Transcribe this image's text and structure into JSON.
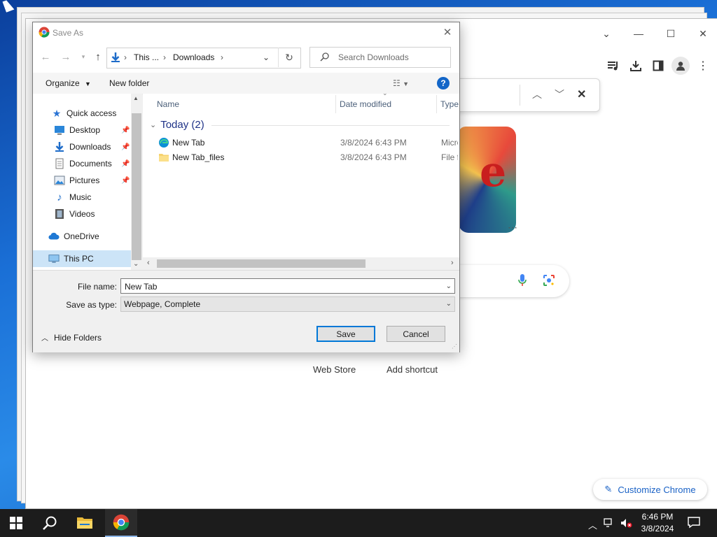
{
  "dialog": {
    "title": "Save As",
    "breadcrumb": [
      "This ...",
      "Downloads"
    ],
    "search_placeholder": "Search Downloads",
    "organize_label": "Organize",
    "new_folder_label": "New folder",
    "help_glyph": "?",
    "nav_pane": {
      "quick_access": "Quick access",
      "pinned": [
        {
          "label": "Desktop",
          "icon": "desktop-icon"
        },
        {
          "label": "Downloads",
          "icon": "downloads-icon"
        },
        {
          "label": "Documents",
          "icon": "documents-icon"
        },
        {
          "label": "Pictures",
          "icon": "pictures-icon"
        }
      ],
      "unpinned": [
        {
          "label": "Music",
          "icon": "music-icon"
        },
        {
          "label": "Videos",
          "icon": "videos-icon"
        }
      ],
      "onedrive": "OneDrive",
      "this_pc": "This PC"
    },
    "columns": {
      "name": "Name",
      "date_modified": "Date modified",
      "type": "Type"
    },
    "group": {
      "label": "Today (2)"
    },
    "files": [
      {
        "name": "New Tab",
        "date": "3/8/2024 6:43 PM",
        "type": "Micro",
        "icon": "edge-html-icon"
      },
      {
        "name": "New Tab_files",
        "date": "3/8/2024 6:43 PM",
        "type": "File fo",
        "icon": "folder-icon"
      }
    ],
    "file_name_label": "File name:",
    "file_name_value": "New Tab",
    "save_type_label": "Save as type:",
    "save_type_value": "Webpage, Complete",
    "hide_folders_label": "Hide Folders",
    "save_label": "Save",
    "cancel_label": "Cancel"
  },
  "chrome": {
    "web_store_label": "Web Store",
    "add_shortcut_label": "Add shortcut",
    "customize_label": "Customize Chrome",
    "accent": "#1a62c6"
  },
  "taskbar": {
    "time": "6:46 PM",
    "date": "3/8/2024"
  }
}
